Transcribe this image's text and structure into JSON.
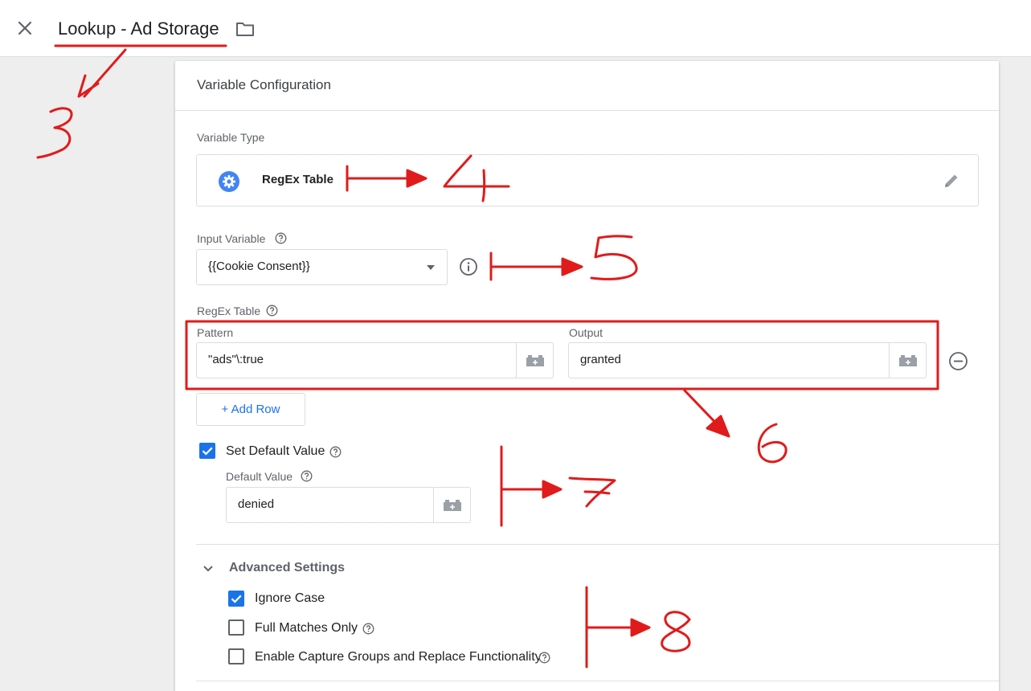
{
  "header": {
    "title": "Lookup - Ad Storage",
    "close_icon": "close-icon",
    "folder_icon": "folder-icon"
  },
  "card": {
    "title": "Variable Configuration"
  },
  "variable_type": {
    "label": "Variable Type",
    "name": "RegEx Table",
    "icon": "gear-icon",
    "edit_icon": "pencil-icon"
  },
  "input_variable": {
    "label": "Input Variable",
    "value": "{{Cookie Consent}}"
  },
  "regex_table": {
    "label": "RegEx Table",
    "pattern_header": "Pattern",
    "output_header": "Output",
    "rows": [
      {
        "pattern": "\"ads\"\\:true",
        "output": "granted"
      }
    ],
    "add_row_label": "+ Add Row"
  },
  "default_value": {
    "checkbox_label": "Set Default Value",
    "checked": true,
    "field_label": "Default Value",
    "value": "denied"
  },
  "advanced": {
    "title": "Advanced Settings",
    "options": [
      {
        "label": "Ignore Case",
        "checked": true
      },
      {
        "label": "Full Matches Only",
        "checked": false
      },
      {
        "label": "Enable Capture Groups and Replace Functionality",
        "checked": false
      }
    ]
  },
  "annotations": {
    "color": "#e01b1b",
    "numbers": [
      "3",
      "4",
      "5",
      "6",
      "7",
      "8"
    ]
  }
}
